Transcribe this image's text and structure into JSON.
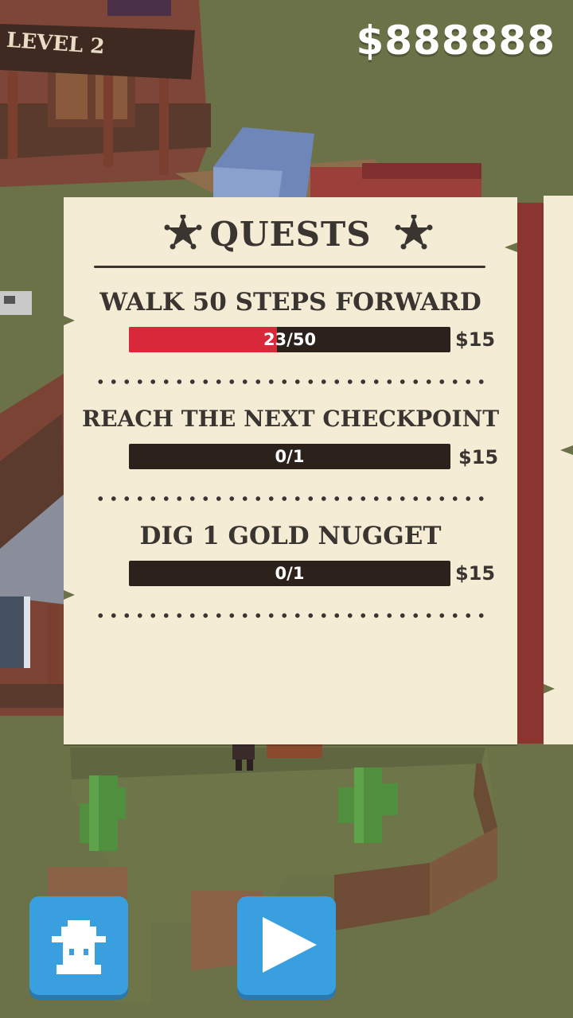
{
  "hud": {
    "money": "$888888",
    "level_sign": "LEVEL 2"
  },
  "quests_panel": {
    "title": "QUESTS",
    "quests": [
      {
        "name": "WALK 50 STEPS FORWARD",
        "progress_text": "23/50",
        "progress": 0.46,
        "reward": "$15"
      },
      {
        "name": "REACH THE NEXT CHECKPOINT",
        "progress_text": "0/1",
        "progress": 0,
        "reward": "$15"
      },
      {
        "name": "DIG 1 GOLD NUGGET",
        "progress_text": "0/1",
        "progress": 0,
        "reward": "$15"
      }
    ]
  },
  "buttons": {
    "character_icon": "cowboy-character-icon",
    "play_icon": "play-icon"
  },
  "colors": {
    "ground": "#6b7247",
    "paper": "#f5ecd6",
    "ink": "#3a3530",
    "bar_bg": "#2d211b",
    "bar_fill": "#d8283a",
    "button": "#3a9fdf"
  }
}
